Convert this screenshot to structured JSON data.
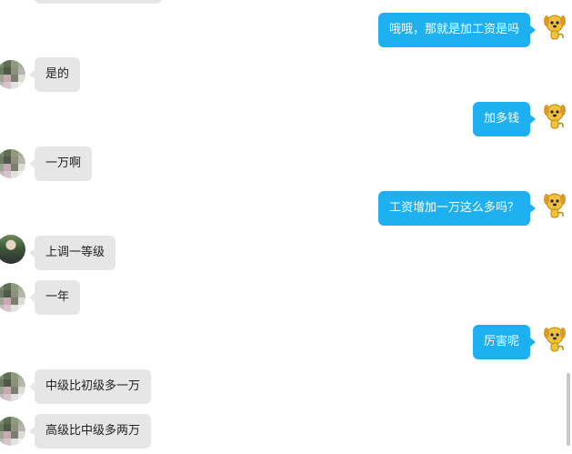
{
  "messages": [
    {
      "side": "right",
      "text": "哦哦，那就是加工资是吗"
    },
    {
      "side": "left",
      "text": "是的"
    },
    {
      "side": "right",
      "text": "加多钱"
    },
    {
      "side": "left",
      "text": "一万啊"
    },
    {
      "side": "right",
      "text": "工资增加一万这么多吗？"
    },
    {
      "side": "left",
      "text": "上调一等级"
    },
    {
      "side": "left",
      "text": "一年"
    },
    {
      "side": "right",
      "text": "厉害呢"
    },
    {
      "side": "left",
      "text": "中级比初级多一万"
    },
    {
      "side": "left",
      "text": "高级比中级多两万"
    }
  ],
  "avatars": {
    "left_pixelated": "pixelated-avatar",
    "left_photo": "user-photo-avatar",
    "right": "cartoon-dog-avatar"
  }
}
